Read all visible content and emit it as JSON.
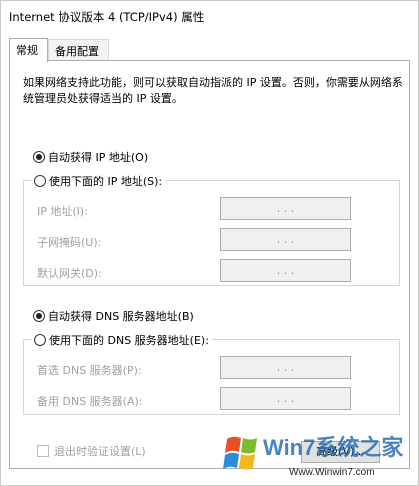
{
  "window": {
    "title": "Internet 协议版本 4 (TCP/IPv4) 属性"
  },
  "tabs": [
    {
      "label": "常规",
      "active": true
    },
    {
      "label": "备用配置",
      "active": false
    }
  ],
  "description": "如果网络支持此功能，则可以获取自动指派的 IP 设置。否则，你需要从网络系统管理员处获得适当的 IP 设置。",
  "ip_section": {
    "auto_label": "自动获得 IP 地址(O)",
    "auto_checked": true,
    "manual_label": "使用下面的 IP 地址(S):",
    "manual_checked": false,
    "fields": [
      {
        "label": "IP 地址(I):",
        "value": ". . ."
      },
      {
        "label": "子网掩码(U):",
        "value": ". . ."
      },
      {
        "label": "默认网关(D):",
        "value": ". . ."
      }
    ]
  },
  "dns_section": {
    "auto_label": "自动获得 DNS 服务器地址(B)",
    "auto_checked": true,
    "manual_label": "使用下面的 DNS 服务器地址(E):",
    "manual_checked": false,
    "fields": [
      {
        "label": "首选 DNS 服务器(P):",
        "value": ". . ."
      },
      {
        "label": "备用 DNS 服务器(A):",
        "value": ". . ."
      }
    ]
  },
  "validate_on_exit": {
    "label": "退出时验证设置(L)",
    "checked": false
  },
  "advanced_button": "高级(V)...",
  "watermark": {
    "brand": "Win7系统之家",
    "url": "Www.Winwin7.com"
  },
  "colors": {
    "disabled_text": "#a0a0a0",
    "border": "#adadad",
    "field_bg": "#f0f0f0"
  }
}
